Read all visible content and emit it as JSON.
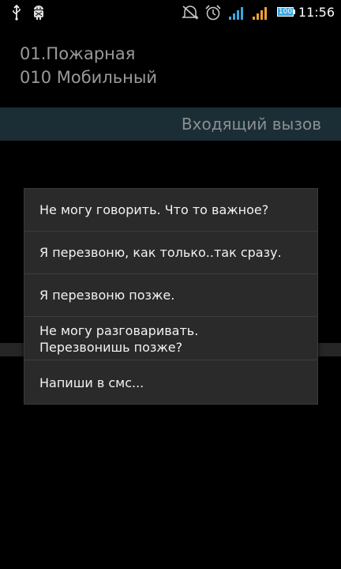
{
  "status_bar": {
    "time": "11:56",
    "battery_label": "100",
    "icons": [
      "usb-icon",
      "android-debug-icon",
      "muted-ringer-icon",
      "alarm-icon",
      "signal-blue-icon",
      "signal-orange-icon",
      "battery-icon"
    ],
    "colors": {
      "signal_blue": "#3aa6e0",
      "signal_orange": "#f0a030",
      "battery_fill": "#3aa6e0"
    }
  },
  "caller": {
    "name": "01.Пожарная",
    "number": "010 Мобильный"
  },
  "banner": {
    "label": "Входящий вызов"
  },
  "quick_reply": {
    "items": [
      {
        "text": "Не могу говорить. Что то важное?"
      },
      {
        "text": "Я перезвоню, как только..так сразу."
      },
      {
        "text": "Я перезвоню позже."
      },
      {
        "text_line1": "Не могу разговаривать.",
        "text_line2": "Перезвонишь позже?"
      },
      {
        "text": "Напиши в смс..."
      }
    ]
  }
}
